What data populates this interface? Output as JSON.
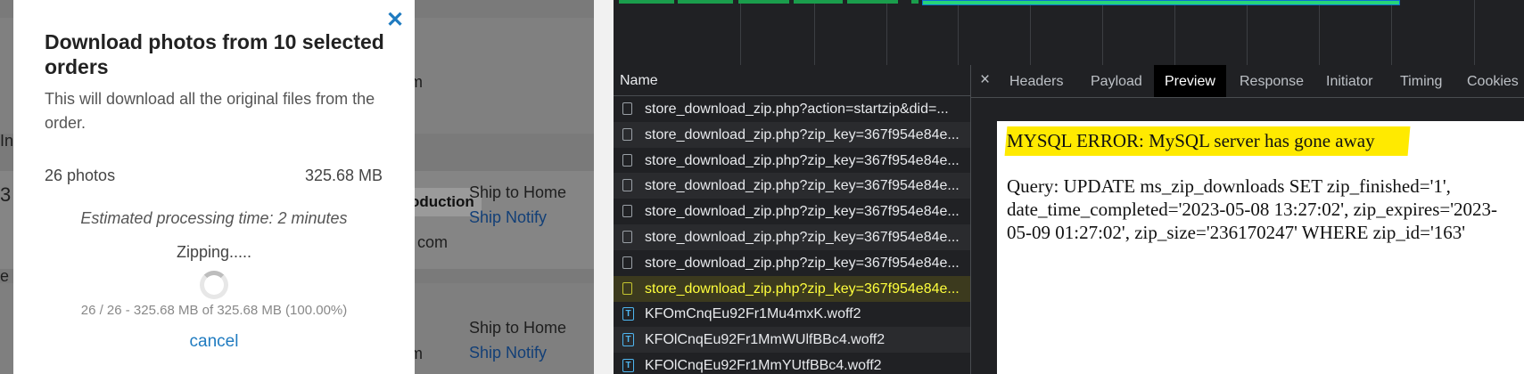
{
  "modal": {
    "close_glyph": "✕",
    "title": "Download photos from 10 selected orders",
    "description": "This will download all the original files from the order.",
    "photo_count": "26 photos",
    "total_size": "325.68 MB",
    "estimate": "Estimated processing time: 2 minutes",
    "status": "Zipping.....",
    "progress": "26 / 26 - 325.68 MB of 325.68 MB (100.00%)",
    "progress_fraction": 1.0,
    "cancel_label": "cancel"
  },
  "background_page": {
    "fragments": [
      "m",
      "In",
      "3",
      "oduction",
      "Ship to Home",
      "Ship Notify",
      "com",
      "e",
      "Ship to Home",
      "Ship Notify",
      "m"
    ]
  },
  "devtools": {
    "list_header": "Name",
    "requests": [
      {
        "name": "store_download_zip.php?action=startzip&did=...",
        "type": "doc"
      },
      {
        "name": "store_download_zip.php?zip_key=367f954e84e...",
        "type": "doc"
      },
      {
        "name": "store_download_zip.php?zip_key=367f954e84e...",
        "type": "doc"
      },
      {
        "name": "store_download_zip.php?zip_key=367f954e84e...",
        "type": "doc"
      },
      {
        "name": "store_download_zip.php?zip_key=367f954e84e...",
        "type": "doc"
      },
      {
        "name": "store_download_zip.php?zip_key=367f954e84e...",
        "type": "doc"
      },
      {
        "name": "store_download_zip.php?zip_key=367f954e84e...",
        "type": "doc"
      },
      {
        "name": "store_download_zip.php?zip_key=367f954e84e...",
        "type": "doc",
        "selected": true
      },
      {
        "name": "KFOmCnqEu92Fr1Mu4mxK.woff2",
        "type": "font"
      },
      {
        "name": "KFOlCnqEu92Fr1MmWUlfBBc4.woff2",
        "type": "font"
      },
      {
        "name": "KFOlCnqEu92Fr1MmYUtfBBc4.woff2",
        "type": "font"
      }
    ],
    "detail_close_glyph": "×",
    "tabs": [
      "Headers",
      "Payload",
      "Preview",
      "Response",
      "Initiator",
      "Timing",
      "Cookies"
    ],
    "active_tab": "Preview",
    "preview": {
      "title": "MYSQL ERROR: MySQL server has gone away",
      "query": "Query: UPDATE ms_zip_downloads SET zip_finished='1', date_time_completed='2023-05-08 13:27:02', zip_expires='2023-05-09 01:27:02', zip_size='236170247' WHERE zip_id='163'"
    },
    "colors": {
      "panel_bg": "#202124",
      "selected_text": "#ffff3c",
      "highlight": "#ffea00",
      "waterfall_green": "#1a9d4c"
    }
  }
}
